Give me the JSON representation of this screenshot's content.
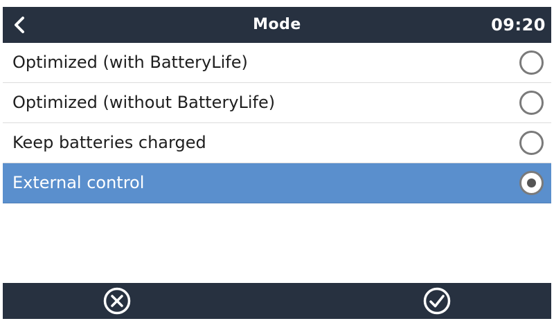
{
  "header": {
    "title": "Mode",
    "time": "09:20",
    "back_icon": "chevron-left-icon"
  },
  "options": [
    {
      "label": "Optimized (with BatteryLife)",
      "selected": false
    },
    {
      "label": "Optimized (without BatteryLife)",
      "selected": false
    },
    {
      "label": "Keep batteries charged",
      "selected": false
    },
    {
      "label": "External control",
      "selected": true
    }
  ],
  "footer": {
    "cancel_icon": "close-circle-icon",
    "confirm_icon": "check-circle-icon"
  },
  "colors": {
    "header_bg": "#273140",
    "selected_row_bg": "#5a8fcd",
    "radio_border": "#7a7a7a"
  }
}
